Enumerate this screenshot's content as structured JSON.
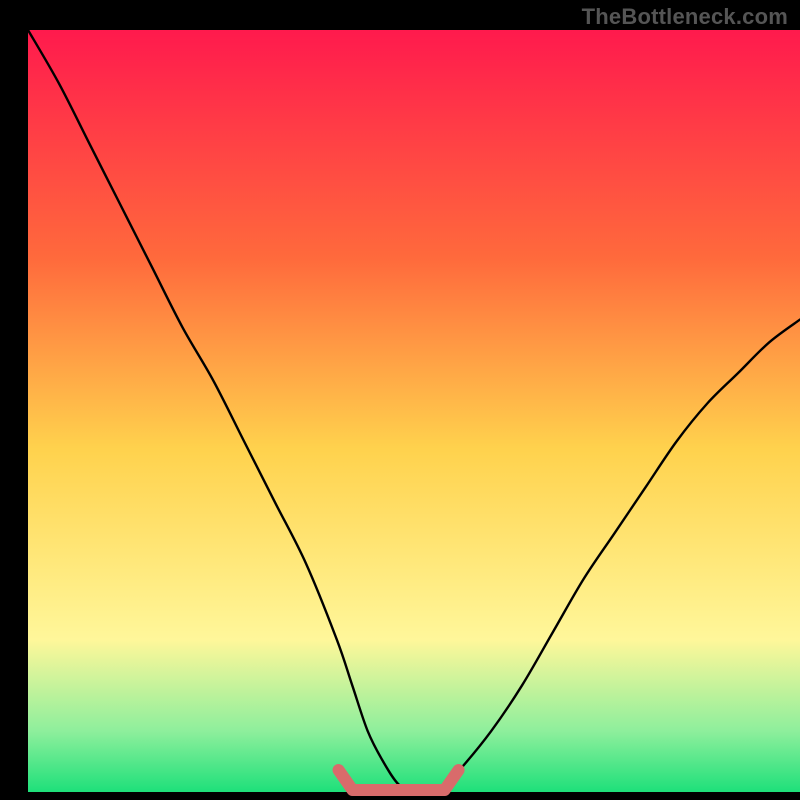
{
  "watermark": {
    "label": "TheBottleneck.com"
  },
  "colors": {
    "black": "#000000",
    "grad_top": "#ff1a4d",
    "grad_mid_upper": "#ff7a33",
    "grad_mid": "#ffd84d",
    "grad_lower": "#fff79a",
    "grad_green": "#5eea7e",
    "grad_green_deep": "#1ee07a",
    "curve": "#000000",
    "mark": "#d96b6b"
  },
  "chart_data": {
    "type": "line",
    "title": "",
    "xlabel": "",
    "ylabel": "",
    "xlim": [
      0,
      100
    ],
    "ylim": [
      0,
      100
    ],
    "series": [
      {
        "name": "bottleneck-curve",
        "x": [
          0,
          4,
          8,
          12,
          16,
          20,
          24,
          28,
          32,
          36,
          40,
          42,
          44,
          46,
          48,
          50,
          52,
          54,
          56,
          60,
          64,
          68,
          72,
          76,
          80,
          84,
          88,
          92,
          96,
          100
        ],
        "y": [
          100,
          93,
          85,
          77,
          69,
          61,
          54,
          46,
          38,
          30,
          20,
          14,
          8,
          4,
          1,
          0,
          0,
          1,
          3,
          8,
          14,
          21,
          28,
          34,
          40,
          46,
          51,
          55,
          59,
          62
        ]
      }
    ],
    "flat_region": {
      "x_start": 41,
      "x_end": 55,
      "y": 0
    },
    "gradient_stops": [
      {
        "offset": 0.0,
        "color": "#ff1a4d"
      },
      {
        "offset": 0.3,
        "color": "#ff6a3c"
      },
      {
        "offset": 0.55,
        "color": "#ffd24d"
      },
      {
        "offset": 0.8,
        "color": "#fff79a"
      },
      {
        "offset": 0.92,
        "color": "#8eef9c"
      },
      {
        "offset": 1.0,
        "color": "#1ee07a"
      }
    ]
  }
}
